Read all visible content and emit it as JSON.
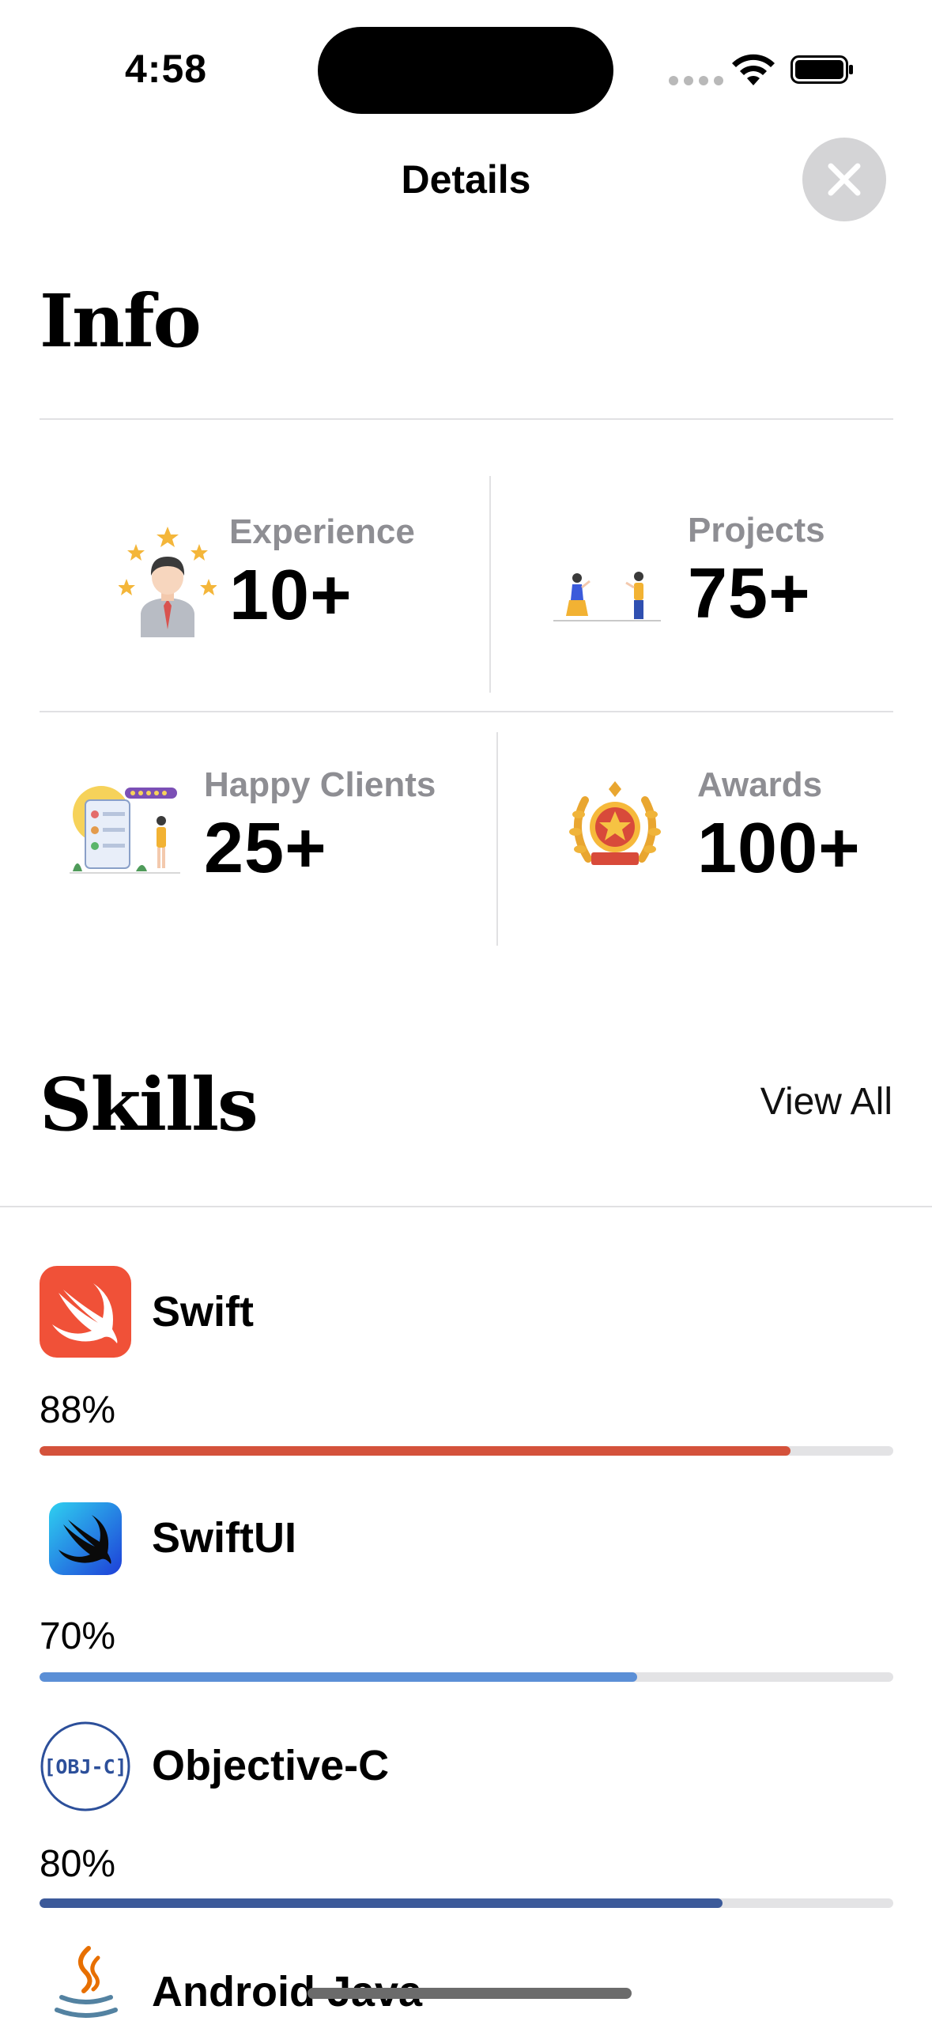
{
  "status_bar": {
    "time": "4:58"
  },
  "nav": {
    "title": "Details",
    "close_icon": "close-icon"
  },
  "info": {
    "title": "Info",
    "stats": [
      {
        "label": "Experience",
        "value": "10+"
      },
      {
        "label": "Projects",
        "value": "75+"
      },
      {
        "label": "Happy Clients",
        "value": "25+"
      },
      {
        "label": "Awards",
        "value": "100+"
      }
    ]
  },
  "skills": {
    "title": "Skills",
    "view_all": "View All",
    "items": [
      {
        "name": "Swift",
        "percent_label": "88%",
        "progress": 0.88,
        "color": "#d4523b",
        "icon": "swift-icon"
      },
      {
        "name": "SwiftUI",
        "percent_label": "70%",
        "progress": 0.7,
        "color": "#5b8fd6",
        "icon": "swiftui-icon"
      },
      {
        "name": "Objective-C",
        "percent_label": "80%",
        "progress": 0.8,
        "color": "#3c5a9a",
        "icon": "objc-icon",
        "icon_text": "[OBJ-C]"
      },
      {
        "name": "Android Java",
        "icon": "java-icon"
      }
    ]
  },
  "colors": {
    "accent_swift": "#f05138",
    "divider": "#e1e1e3",
    "secondary_text": "#8e8e93"
  }
}
